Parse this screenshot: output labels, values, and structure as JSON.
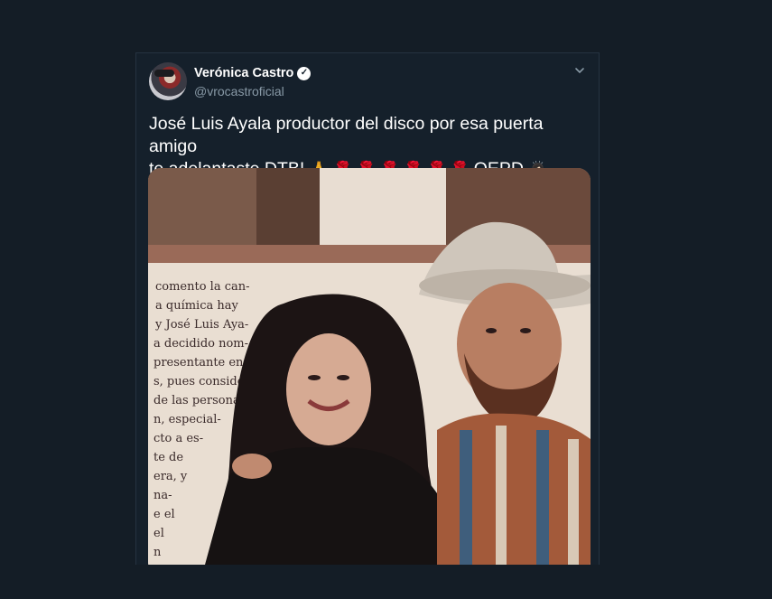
{
  "tweet": {
    "display_name": "Verónica Castro",
    "handle": "@vrocastroficial",
    "text_line1": "José Luis Ayala productor del disco por esa puerta amigo",
    "text_line2_prefix": "te adelantaste DTB!",
    "text_line2_suffix": "QEPD",
    "emoji_pray": "🙏",
    "emoji_rose": "🌹",
    "emoji_person": "🙇🏻‍♀️",
    "rose_count": 6
  },
  "icons": {
    "verified": "verified-badge-icon",
    "menu": "chevron-down-icon"
  },
  "media": {
    "clipping_text": [
      "comento la can-",
      "a química hay",
      "y José Luis Aya-",
      "a decidido nom-",
      "presentante en",
      "s, pues conside-",
      "de las personas",
      "n, especial-",
      "cto a es-",
      "te de",
      "era, y",
      "na-",
      "e el",
      "el",
      "n"
    ]
  },
  "colors": {
    "background": "#141d26",
    "card": "#15202b",
    "secondary_text": "#8899a6"
  }
}
